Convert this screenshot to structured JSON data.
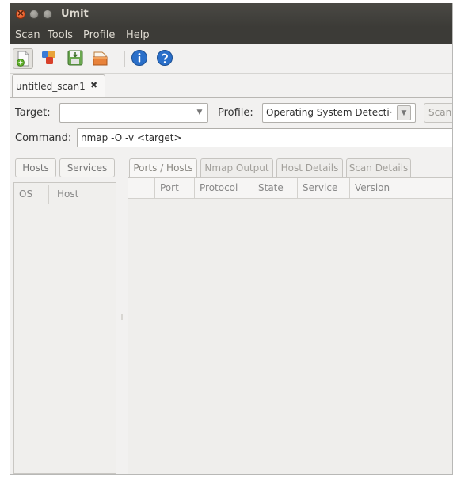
{
  "window": {
    "title": "Umit"
  },
  "menu": {
    "items": [
      "Scan",
      "Tools",
      "Profile",
      "Help"
    ]
  },
  "toolbar": {
    "buttons": [
      {
        "name": "new-scan",
        "icon": "new-document-icon"
      },
      {
        "name": "command-wizard",
        "icon": "wizard-icon"
      },
      {
        "name": "save-scan",
        "icon": "save-icon"
      },
      {
        "name": "open-scan",
        "icon": "folder-icon"
      },
      {
        "name": "about",
        "icon": "info-icon"
      },
      {
        "name": "help",
        "icon": "help-icon"
      }
    ]
  },
  "scan_tab": {
    "label": "untitled_scan1",
    "close_glyph": "✖"
  },
  "target": {
    "label": "Target:",
    "value": "",
    "arrow": "▼"
  },
  "profile": {
    "label": "Profile:",
    "value": "Operating System Detecti·",
    "arrow": "▼"
  },
  "scan_button": {
    "label": "Scan"
  },
  "command": {
    "label": "Command:",
    "value": "nmap -O -v <target>"
  },
  "left_panel": {
    "buttons": [
      "Hosts",
      "Services"
    ],
    "columns": [
      "OS",
      "Host"
    ]
  },
  "right_tabs": [
    "Ports / Hosts",
    "Nmap Output",
    "Host Details",
    "Scan Details"
  ],
  "ports_table": {
    "columns": [
      "Port",
      "Protocol",
      "State",
      "Service",
      "Version"
    ]
  },
  "colors": {
    "titlebar": "#3c3b37",
    "close_button": "#dd4814",
    "window_bg": "#f2f1f0"
  }
}
